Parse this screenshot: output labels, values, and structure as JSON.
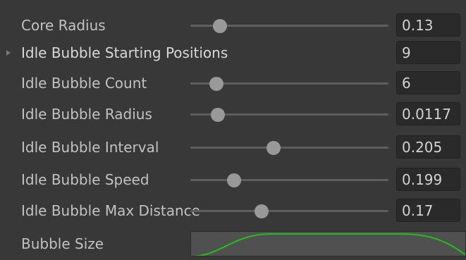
{
  "inspector": {
    "rows": [
      {
        "label": "Core Radius",
        "value": "0.13",
        "slider": 0.15
      },
      {
        "label": "Idle Bubble Starting Positions",
        "value": "9"
      },
      {
        "label": "Idle Bubble Count",
        "value": "6",
        "slider": 0.13
      },
      {
        "label": "Idle Bubble Radius",
        "value": "0.0117",
        "slider": 0.14
      },
      {
        "label": "Idle Bubble Interval",
        "value": "0.205",
        "slider": 0.42
      },
      {
        "label": "Idle Bubble Speed",
        "value": "0.199",
        "slider": 0.22
      },
      {
        "label": "Idle Bubble Max Distance",
        "value": "0.17",
        "slider": 0.36
      }
    ],
    "bubble_size": {
      "label": "Bubble Size",
      "curve_color": "#1fbf1f"
    }
  },
  "colors": {
    "background": "#383838",
    "field_background": "#2a2a2a",
    "slider_thumb": "#999999",
    "slider_track": "#5e5e5e"
  }
}
